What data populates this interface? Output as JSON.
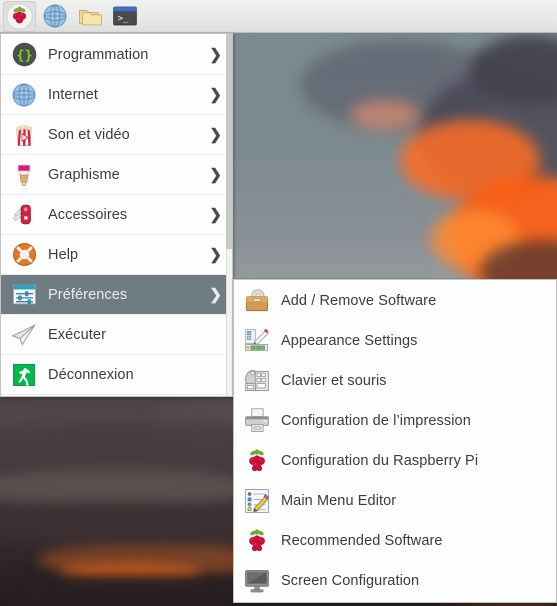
{
  "taskbar": {
    "items": [
      {
        "name": "raspberry-menu-button",
        "icon": "raspberry-pi-icon",
        "label": "",
        "active": true
      },
      {
        "name": "web-browser-button",
        "icon": "globe-icon",
        "label": "",
        "active": false
      },
      {
        "name": "file-manager-button",
        "icon": "folders-icon",
        "label": "",
        "active": false
      },
      {
        "name": "terminal-button",
        "icon": "terminal-icon",
        "label": "",
        "active": false
      }
    ]
  },
  "main_menu": {
    "items": [
      {
        "label": "Programmation",
        "icon": "code-braces-icon",
        "submenu": true,
        "selected": false
      },
      {
        "label": "Internet",
        "icon": "globe-icon",
        "submenu": true,
        "selected": false
      },
      {
        "label": "Son et vidéo",
        "icon": "popcorn-play-icon",
        "submenu": true,
        "selected": false
      },
      {
        "label": "Graphisme",
        "icon": "paintbrush-icon",
        "submenu": true,
        "selected": false
      },
      {
        "label": "Accessoires",
        "icon": "swiss-knife-icon",
        "submenu": true,
        "selected": false
      },
      {
        "label": "Help",
        "icon": "lifebuoy-icon",
        "submenu": true,
        "selected": false
      },
      {
        "label": "Préférences",
        "icon": "preferences-sliders-icon",
        "submenu": true,
        "selected": true
      },
      {
        "label": "Exécuter",
        "icon": "paper-plane-icon",
        "submenu": false,
        "selected": false
      },
      {
        "label": "Déconnexion",
        "icon": "logout-exit-icon",
        "submenu": false,
        "selected": false
      }
    ],
    "arrow_glyph": "❯"
  },
  "sub_menu": {
    "parent": "Préférences",
    "items": [
      {
        "label": "Add / Remove Software",
        "icon": "software-briefcase-cd-icon"
      },
      {
        "label": "Appearance Settings",
        "icon": "color-palette-icon"
      },
      {
        "label": "Clavier et souris",
        "icon": "keyboard-mouse-icon"
      },
      {
        "label": "Configuration de l’impression",
        "icon": "printer-icon"
      },
      {
        "label": "Configuration du Raspberry Pi",
        "icon": "raspberry-pi-icon"
      },
      {
        "label": "Main Menu Editor",
        "icon": "list-pencil-icon"
      },
      {
        "label": "Recommended Software",
        "icon": "raspberry-pi-icon"
      },
      {
        "label": "Screen Configuration",
        "icon": "monitor-icon"
      }
    ]
  },
  "colors": {
    "menu_background": "#fefefe",
    "menu_border": "#c3c3c2",
    "selection": "#6f7c84",
    "text": "#3b3b3b",
    "selected_text": "#e9eced",
    "taskbar_top": "#f0f0ef",
    "taskbar_bottom": "#dededd",
    "raspberry_red": "#c5133b",
    "leaf_green": "#76a72e",
    "accent_orange": "#ff6c24"
  },
  "desktop": {
    "wallpaper_description": "Sunset sky with orange-lit clouds"
  }
}
